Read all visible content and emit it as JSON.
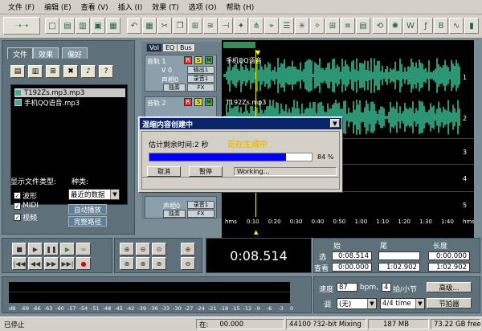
{
  "menu": [
    "文件 (F)",
    "编辑 (E)",
    "查看 (V)",
    "插入 (I)",
    "效果 (T)",
    "选项 (O)",
    "帮助 (H)"
  ],
  "left": {
    "tabs": [
      "文件",
      "效果",
      "偏好"
    ],
    "files": [
      {
        "name": "T192Zs.mp3.mp3",
        "selected": true
      },
      {
        "name": "手机QQ语音.mp3",
        "selected": false
      }
    ],
    "show_type_label": "显示文件类型:",
    "kind_label": "种类:",
    "types": [
      "波形",
      "MIDI",
      "视频"
    ],
    "kind_value": "最近的数据",
    "auto_play": "自动播放",
    "full_path": "完整路径"
  },
  "tracks_header": {
    "tabs": [
      "Vol",
      "EQ",
      "Bus"
    ],
    "tracks": [
      {
        "name": "音轨 1",
        "v": "V 0",
        "pan": "声相0",
        "out": "输出1",
        "out2": "录音1",
        "mode": "独奏",
        "fx": "FX"
      },
      {
        "name": "音轨 2",
        "v": "V 0",
        "pan": "声相0",
        "out": "输出1",
        "out2": "录音1",
        "mode": "独奏",
        "fx": "FX"
      }
    ],
    "bottom": {
      "pan": "声相0",
      "out": "录音1",
      "mode": "独奏",
      "fx": "FX"
    },
    "rsm": [
      "R",
      "S",
      "M"
    ]
  },
  "wave": {
    "clips": [
      "手机QQ语音",
      "T192Zs.mp3"
    ],
    "track_numbers": [
      "1",
      "2",
      "3",
      "4",
      "5"
    ],
    "timeline": [
      "hms",
      "0:10",
      "0:20",
      "0:30",
      "0:40",
      "0:50",
      "1:00",
      "1:10",
      "1:20",
      "1:30",
      "1:40",
      "hms"
    ]
  },
  "dialog": {
    "title": "混缩内容创建中",
    "remaining": "估计剩余时间:2 秒",
    "generating": "正在生成中",
    "percent_text": "84 %",
    "progress": 0.84,
    "cancel": "取消",
    "pause": "暂停",
    "status": "Working..."
  },
  "time_display": "0:08.514",
  "selection": {
    "start_label": "始",
    "end_label": "尾",
    "length_label": "长度",
    "sel_label": "选",
    "view_label": "查看",
    "sel_start": "0:08.514",
    "sel_end": "",
    "sel_length": "0:00.000",
    "view_start": "0:00.000",
    "view_end": "1:02.902",
    "view_length": "1:02.902"
  },
  "level_ticks": [
    "dB",
    "-69",
    "-66",
    "-63",
    "-60",
    "-57",
    "-54",
    "-51",
    "-48",
    "-45",
    "-42",
    "-39",
    "-36",
    "-33",
    "-30",
    "-27",
    "-24",
    "-21",
    "-18",
    "-15",
    "-12",
    "-9",
    "-6",
    "-3",
    "0"
  ],
  "tempo": {
    "speed_label": "速度",
    "speed": "87",
    "bpm": "bpm,",
    "beats": "4",
    "beats_label": "拍/小节",
    "advanced": "高级...",
    "key_label": "调",
    "key_value": "(无)",
    "time_sig": "4/4 time",
    "metronome": "节拍器"
  },
  "status": {
    "state": "已停止",
    "at": "在:",
    "at_value": "00.000",
    "format": "44100 ?32-bit Mixing",
    "mem": "187 MB",
    "disk": "73.22 GB free"
  }
}
